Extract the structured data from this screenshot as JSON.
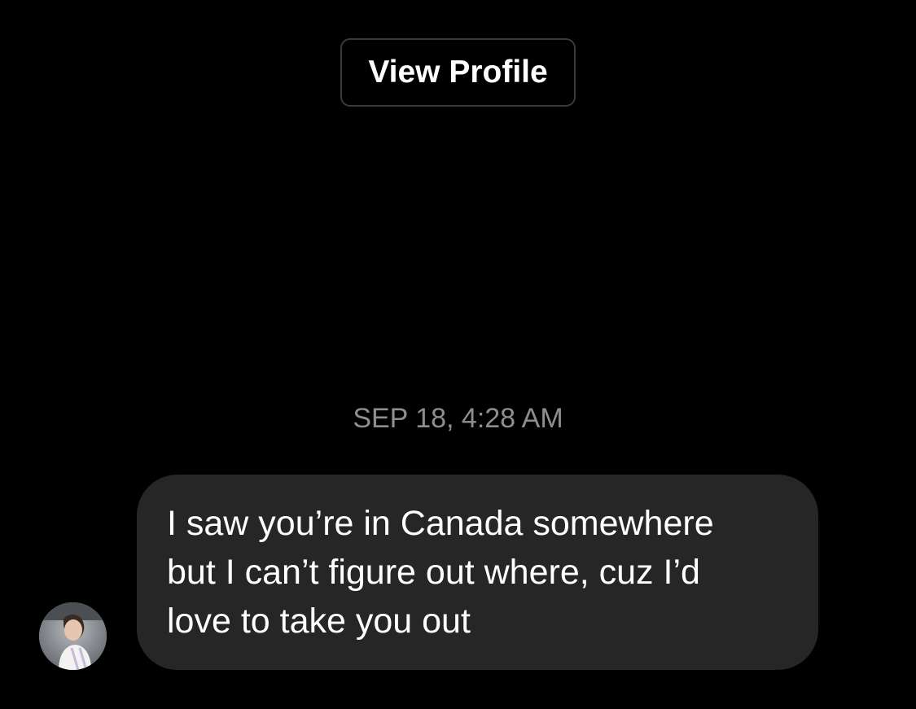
{
  "header": {
    "cut_off_text": "",
    "view_profile_label": "View Profile"
  },
  "thread": {
    "timestamp": "SEP 18, 4:28 AM",
    "messages": [
      {
        "sender": "other",
        "avatar": "user-avatar-photo",
        "lines": [
          "I saw you’re in Canada somewhere",
          "but I can’t figure out where, cuz I’d",
          "love to take you out"
        ]
      }
    ]
  },
  "colors": {
    "background": "#000000",
    "bubble": "#262626",
    "muted_text": "#8e8e8e",
    "button_border": "#3a3a3a",
    "text": "#ffffff"
  }
}
